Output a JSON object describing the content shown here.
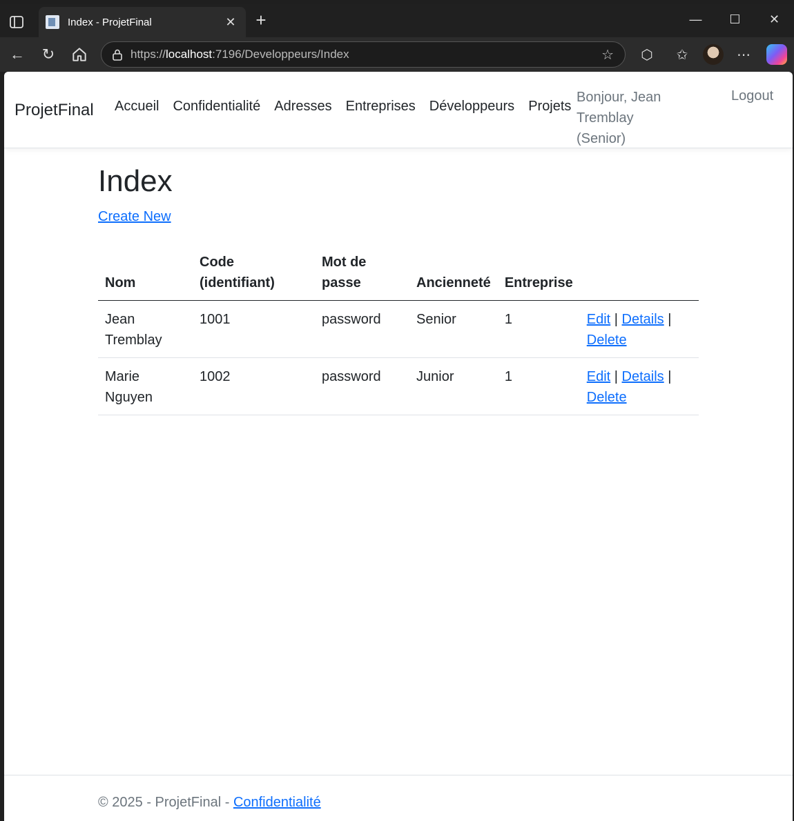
{
  "browser": {
    "tab_title": "Index - ProjetFinal",
    "url_scheme": "https://",
    "url_host": "localhost",
    "url_rest": ":7196/Developpeurs/Index"
  },
  "navbar": {
    "brand": "ProjetFinal",
    "links": [
      "Accueil",
      "Confidentialité",
      "Adresses",
      "Entreprises",
      "Développeurs",
      "Projets"
    ],
    "greeting_line1": "Bonjour, Jean Tremblay",
    "greeting_line2": "(Senior)",
    "logout": "Logout"
  },
  "page": {
    "title": "Index",
    "create_link": "Create New"
  },
  "table": {
    "headers": {
      "nom": "Nom",
      "code_line1": "Code",
      "code_line2": "(identifiant)",
      "mdp_line1": "Mot de",
      "mdp_line2": "passe",
      "anciennete": "Ancienneté",
      "entreprise": "Entreprise"
    },
    "rows": [
      {
        "nom_line1": "Jean",
        "nom_line2": "Tremblay",
        "code": "1001",
        "mdp": "password",
        "anciennete": "Senior",
        "entreprise": "1"
      },
      {
        "nom_line1": "Marie",
        "nom_line2": "Nguyen",
        "code": "1002",
        "mdp": "password",
        "anciennete": "Junior",
        "entreprise": "1"
      }
    ],
    "actions": {
      "edit": "Edit",
      "details": "Details",
      "delete": "Delete",
      "sep": "|"
    }
  },
  "footer": {
    "text": "© 2025 - ProjetFinal - ",
    "link": "Confidentialité"
  }
}
